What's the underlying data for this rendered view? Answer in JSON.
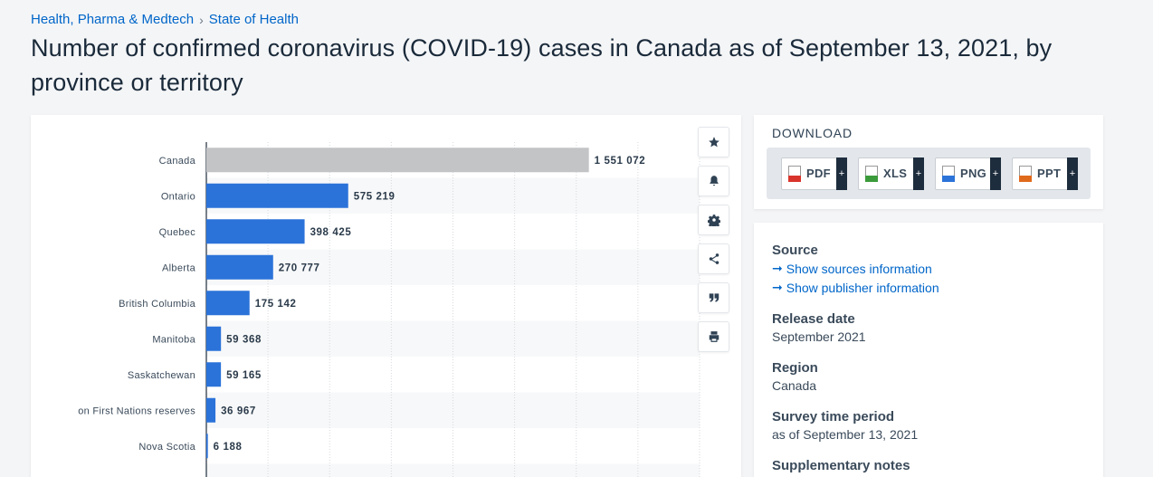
{
  "breadcrumb": {
    "items": [
      "Health, Pharma & Medtech",
      "State of Health"
    ],
    "separator": "›"
  },
  "title": "Number of confirmed coronavirus (COVID-19) cases in Canada as of September 13, 2021, by province or territory",
  "chart_data": {
    "type": "bar",
    "orientation": "horizontal",
    "categories": [
      "Canada",
      "Ontario",
      "Quebec",
      "Alberta",
      "British Columbia",
      "Manitoba",
      "Saskatchewan",
      "on First Nations reserves",
      "Nova Scotia"
    ],
    "values": [
      1551072,
      575219,
      398425,
      270777,
      175142,
      59368,
      59165,
      36967,
      6188
    ],
    "value_labels": [
      "1 551 072",
      "575 219",
      "398 425",
      "270 777",
      "175 142",
      "59 368",
      "59 165",
      "36 967",
      "6 188"
    ],
    "colors": [
      "#c2c4c6",
      "#2b73d9",
      "#2b73d9",
      "#2b73d9",
      "#2b73d9",
      "#2b73d9",
      "#2b73d9",
      "#2b73d9",
      "#2b73d9"
    ],
    "xlim": [
      0,
      2000000
    ],
    "grid": true,
    "legend": "none"
  },
  "toolbar": {
    "icons": [
      "star-icon",
      "bell-icon",
      "gear-icon",
      "share-icon",
      "quote-icon",
      "print-icon"
    ]
  },
  "download": {
    "heading": "DOWNLOAD",
    "buttons": [
      {
        "label": "PDF",
        "color": "#d9342b"
      },
      {
        "label": "XLS",
        "color": "#3b9b3b"
      },
      {
        "label": "PNG",
        "color": "#2b73d9"
      },
      {
        "label": "PPT",
        "color": "#e06a1c"
      }
    ],
    "plus": "+"
  },
  "meta": {
    "source_label": "Source",
    "source_link_1": "Show sources information",
    "source_link_2": "Show publisher information",
    "release_label": "Release date",
    "release_value": "September 2021",
    "region_label": "Region",
    "region_value": "Canada",
    "survey_label": "Survey time period",
    "survey_value": "as of September 13, 2021",
    "supplementary_label": "Supplementary notes",
    "arrow": "➞"
  }
}
